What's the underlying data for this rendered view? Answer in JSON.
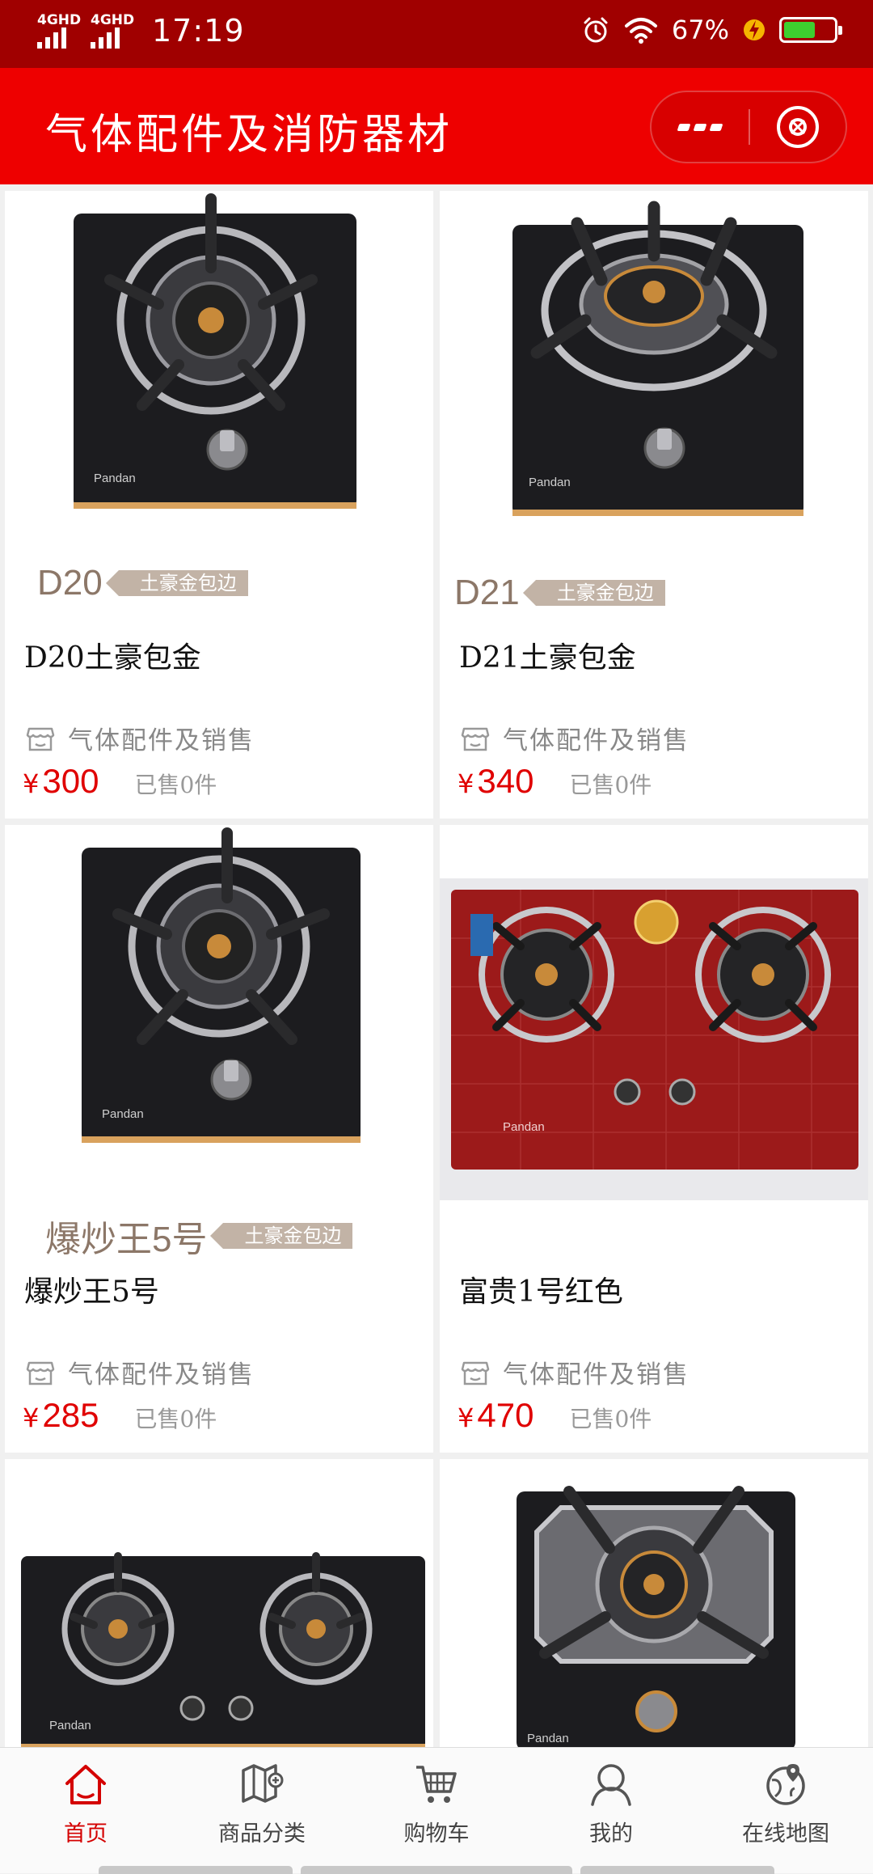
{
  "status_bar": {
    "signal_1": "4GHD",
    "signal_2": "4GHD",
    "time": "17:19",
    "battery_percent": "67%",
    "battery_level": 0.67,
    "icons": [
      "alarm-icon",
      "wifi-icon",
      "charging-bolt-icon",
      "battery-icon"
    ]
  },
  "header": {
    "title": "气体配件及消防器材",
    "more_icon": "more-dots-icon",
    "close_icon": "close-circle-icon"
  },
  "colors": {
    "status_bar_bg": "#a00000",
    "header_bg": "#ee0000",
    "price": "#e00000",
    "active_tab": "#d40000"
  },
  "products": [
    {
      "image_icon": "single-burner-black-stove",
      "brand": "Pandan",
      "sub_model": "D20",
      "sub_tag": "土豪金包边",
      "name": "D20土豪包金",
      "shop": "气体配件及销售",
      "currency": "¥",
      "price": "300",
      "sold": "已售0件"
    },
    {
      "image_icon": "single-burner-black-stove",
      "brand": "Pandan",
      "sub_model": "D21",
      "sub_tag": "土豪金包边",
      "name": "D21土豪包金",
      "shop": "气体配件及销售",
      "currency": "¥",
      "price": "340",
      "sold": "已售0件"
    },
    {
      "image_icon": "single-burner-black-stove",
      "brand": "Pandan",
      "sub_model": "爆炒王5号",
      "sub_tag": "土豪金包边",
      "name": "爆炒王5号",
      "shop": "气体配件及销售",
      "currency": "¥",
      "price": "285",
      "sold": "已售0件"
    },
    {
      "image_icon": "double-burner-red-stove",
      "brand": "Pandan",
      "sub_model": "",
      "sub_tag": "",
      "name": "富贵1号红色",
      "shop": "气体配件及销售",
      "currency": "¥",
      "price": "470",
      "sold": "已售0件"
    },
    {
      "image_icon": "double-burner-black-stove",
      "brand": "Pandan"
    },
    {
      "image_icon": "single-burner-square-stove",
      "brand": "Pandan"
    }
  ],
  "tab_bar": {
    "tabs": [
      {
        "label": "首页",
        "icon": "home-icon",
        "active": true
      },
      {
        "label": "商品分类",
        "icon": "category-map-icon",
        "active": false
      },
      {
        "label": "购物车",
        "icon": "cart-icon",
        "active": false
      },
      {
        "label": "我的",
        "icon": "user-icon",
        "active": false
      },
      {
        "label": "在线地图",
        "icon": "globe-pin-icon",
        "active": false
      }
    ]
  }
}
